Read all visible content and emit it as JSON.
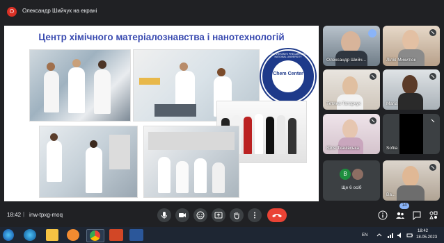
{
  "presenter": {
    "initial": "О",
    "label": "Олександр Шийчук на екрані"
  },
  "slide": {
    "title": "Центр хімічного матеріалознавства і нанотехнологій",
    "logo_center": "Chem Center",
    "logo_ring": "VASYL STEFANYK PRECARPATHIAN NATIONAL UNIVERSITY"
  },
  "participants": [
    {
      "name": "Олександр Шийч...",
      "muted": false,
      "speaking": true
    },
    {
      "name": "Лілія Микитюк",
      "muted": true
    },
    {
      "name": "Тетяна Татарчук",
      "muted": true
    },
    {
      "name": "Maria",
      "muted": true
    },
    {
      "name": "Юля Ткачівська",
      "muted": true
    },
    {
      "name": "Sofiia",
      "muted": true
    },
    {
      "name": "Ще 6 осіб",
      "muted": false
    },
    {
      "name": "Ва...",
      "muted": true
    }
  ],
  "more_tile": {
    "initial": "В"
  },
  "meeting": {
    "time": "18:42",
    "separator": "|",
    "code": "inw-tpxg-moq",
    "participants_count": "14"
  },
  "taskbar": {
    "lang": "EN",
    "time": "18:42",
    "date": "18.05.2023"
  },
  "colors": {
    "accent": "#3a4bb0",
    "end_call": "#ea4335",
    "background": "#202124"
  }
}
